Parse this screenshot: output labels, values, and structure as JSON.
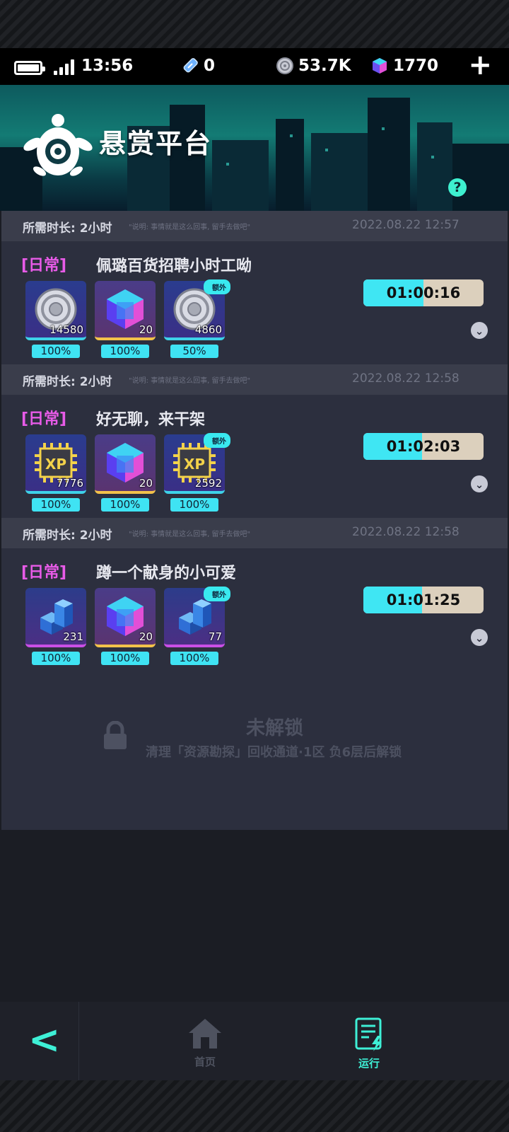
{
  "status_bar": {
    "time": "13:56",
    "ticket_count": "0",
    "coin_count": "53.7K",
    "cube_count": "1770",
    "add_label": "+"
  },
  "banner": {
    "title": "悬赏平台",
    "help_label": "?"
  },
  "quests": [
    {
      "duration": "所需时长: 2小时",
      "quote": "\"说明: 事情就是这么回事, 留手去做吧\"",
      "date": "2022.08.22 12:57",
      "tag": "[日常]",
      "title": "佩璐百货招聘小时工呦",
      "rewards": [
        {
          "icon": "silver-coin-icon",
          "count": "14580",
          "percent": "100%",
          "extra": ""
        },
        {
          "icon": "blue-cube-icon",
          "count": "20",
          "percent": "100%",
          "extra": ""
        },
        {
          "icon": "silver-coin-icon",
          "count": "4860",
          "percent": "50%",
          "extra": "额外"
        }
      ],
      "timer": "01:00:16",
      "timer_progress": 0.5
    },
    {
      "duration": "所需时长: 2小时",
      "quote": "\"说明: 事情就是这么回事, 留手去做吧\"",
      "date": "2022.08.22 12:58",
      "tag": "[日常]",
      "title": "好无聊，来干架",
      "rewards": [
        {
          "icon": "xp-chip-icon",
          "count": "7776",
          "percent": "100%",
          "extra": ""
        },
        {
          "icon": "blue-cube-icon",
          "count": "20",
          "percent": "100%",
          "extra": ""
        },
        {
          "icon": "xp-chip-icon",
          "count": "2592",
          "percent": "100%",
          "extra": "额外"
        }
      ],
      "timer": "01:02:03",
      "timer_progress": 0.49
    },
    {
      "duration": "所需时长: 2小时",
      "quote": "\"说明: 事情就是这么回事, 留手去做吧\"",
      "date": "2022.08.22 12:58",
      "tag": "[日常]",
      "title": "蹲一个献身的小可爱",
      "rewards": [
        {
          "icon": "blue-blocks-icon",
          "count": "231",
          "percent": "100%",
          "extra": ""
        },
        {
          "icon": "blue-cube-icon",
          "count": "20",
          "percent": "100%",
          "extra": ""
        },
        {
          "icon": "blue-blocks-icon",
          "count": "77",
          "percent": "100%",
          "extra": "额外"
        }
      ],
      "timer": "01:01:25",
      "timer_progress": 0.49
    }
  ],
  "locked_slot": {
    "title": "未解锁",
    "subtitle": "清理「资源勘探」回收通道·1区 负6层后解锁"
  },
  "nav": {
    "back_label": "<",
    "home_label": "首页",
    "run_label": "运行"
  },
  "colors": {
    "accent_cyan": "#3fe6f3",
    "tag_pink": "#e85be8",
    "card_bg": "#2c2f3e",
    "meta_bg": "#3a3d4b"
  }
}
